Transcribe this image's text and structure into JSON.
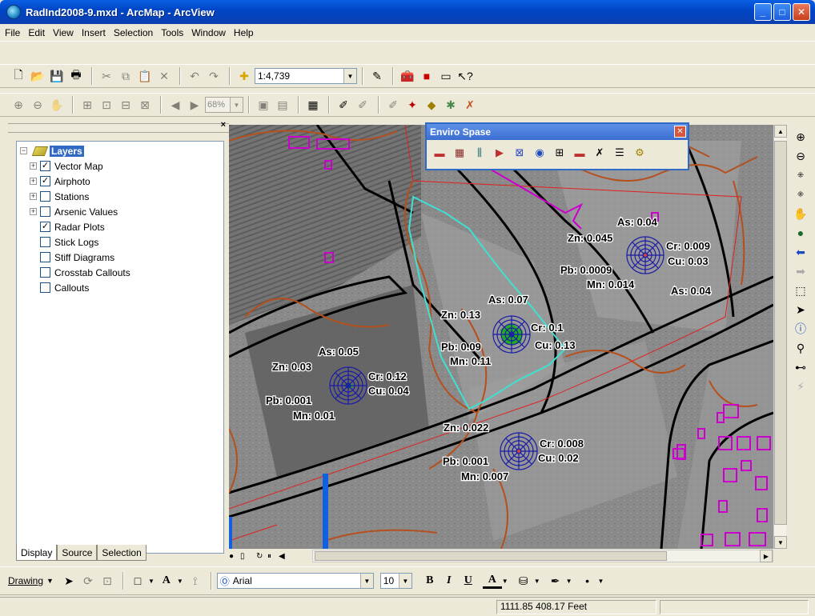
{
  "window": {
    "title": "RadInd2008-9.mxd - ArcMap - ArcView"
  },
  "menu": [
    "File",
    "Edit",
    "View",
    "Insert",
    "Selection",
    "Tools",
    "Window",
    "Help"
  ],
  "toolbar": {
    "scale": "1:4,739",
    "zoom_percent": "68%"
  },
  "toc": {
    "root": "Layers",
    "layers": [
      {
        "label": "Vector Map",
        "checked": true,
        "expandable": true
      },
      {
        "label": "Airphoto",
        "checked": true,
        "expandable": true
      },
      {
        "label": "Stations",
        "checked": false,
        "expandable": true
      },
      {
        "label": "Arsenic Values",
        "checked": false,
        "expandable": true
      },
      {
        "label": "Radar Plots",
        "checked": true,
        "expandable": false
      },
      {
        "label": "Stick Logs",
        "checked": false,
        "expandable": false
      },
      {
        "label": "Stiff Diagrams",
        "checked": false,
        "expandable": false
      },
      {
        "label": "Crosstab Callouts",
        "checked": false,
        "expandable": false
      },
      {
        "label": "Callouts",
        "checked": false,
        "expandable": false
      }
    ],
    "tabs": [
      "Display",
      "Source",
      "Selection"
    ]
  },
  "enviro_toolbar": {
    "title": "Enviro Spase"
  },
  "map": {
    "plots": [
      {
        "as": "As: 0.04",
        "zn": "Zn: 0.045",
        "cr": "Cr: 0.009",
        "cu": "Cu: 0.03",
        "pb": "Pb: 0.0009",
        "mn": "Mn: 0.014",
        "extra": "As: 0.04"
      },
      {
        "as": "As: 0.07",
        "zn": "Zn: 0.13",
        "cr": "Cr: 0.1",
        "cu": "Cu: 0.13",
        "pb": "Pb: 0.09",
        "mn": "Mn: 0.11"
      },
      {
        "as": "As: 0.05",
        "zn": "Zn: 0.03",
        "cr": "Cr: 0.12",
        "cu": "Cu: 0.04",
        "pb": "Pb: 0.001",
        "mn": "Mn: 0.01"
      },
      {
        "zn": "Zn: 0.022",
        "cr": "Cr: 0.008",
        "cu": "Cu: 0.02",
        "pb": "Pb: 0.001",
        "mn": "Mn: 0.007"
      }
    ]
  },
  "drawing": {
    "menu_label": "Drawing",
    "font": "Arial",
    "size": "10",
    "bold": "B",
    "italic": "I",
    "underline": "U",
    "font_color_glyph": "A"
  },
  "status": {
    "coords": "1111.85  408.17 Feet"
  },
  "colors": {
    "title_bar": "#0a5fe3",
    "selection": "#316ac5",
    "plot_ring": "#1a1aa8",
    "plot_fill": "#22aa22",
    "building": "#cc00cc",
    "contour": "#b5501e",
    "boundary": "#40e0d0"
  }
}
